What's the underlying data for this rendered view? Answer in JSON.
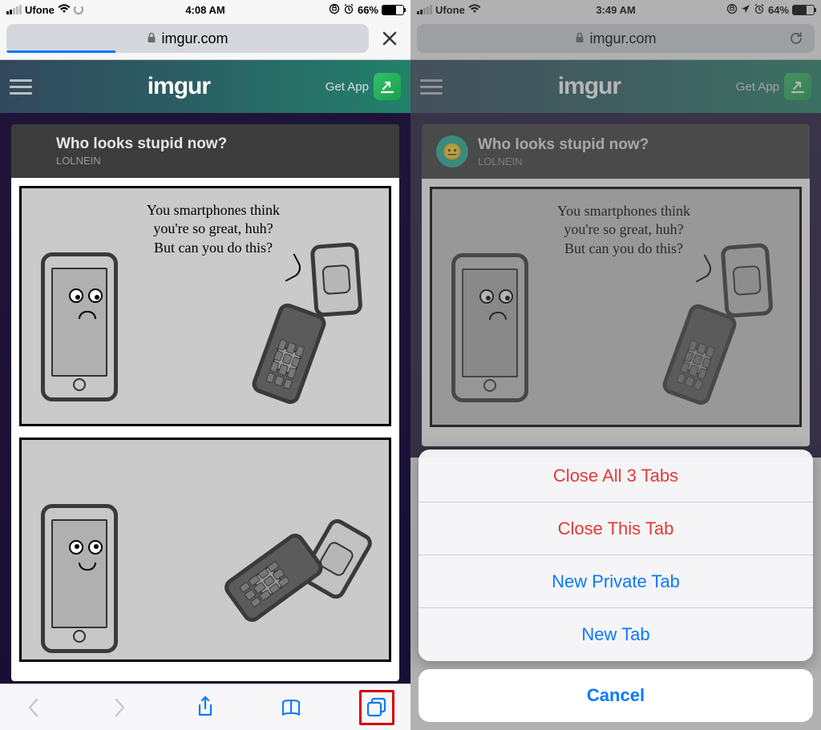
{
  "left": {
    "status": {
      "carrier": "Ufone",
      "time": "4:08 AM",
      "battery_pct": "66%",
      "signal_bars_on": 2
    },
    "url": {
      "domain": "imgur.com",
      "loading": true
    },
    "imgur": {
      "get_app": "Get App",
      "logo": "imgur"
    },
    "post": {
      "title": "Who looks stupid now?",
      "author": "LOLNEIN",
      "panel1_text": "You smartphones think\nyou're so great, huh?\nBut can you do this?"
    }
  },
  "right": {
    "status": {
      "carrier": "Ufone",
      "time": "3:49 AM",
      "battery_pct": "64%",
      "signal_bars_on": 2
    },
    "url": {
      "domain": "imgur.com",
      "loading": false
    },
    "imgur": {
      "get_app": "Get App",
      "logo": "imgur"
    },
    "post": {
      "title": "Who looks stupid now?",
      "author": "LOLNEIN",
      "panel1_text": "You smartphones think\nyou're so great, huh?\nBut can you do this?"
    },
    "sheet": {
      "close_all": "Close All 3 Tabs",
      "close_this": "Close This Tab",
      "new_private": "New Private Tab",
      "new_tab": "New Tab",
      "cancel": "Cancel"
    }
  }
}
